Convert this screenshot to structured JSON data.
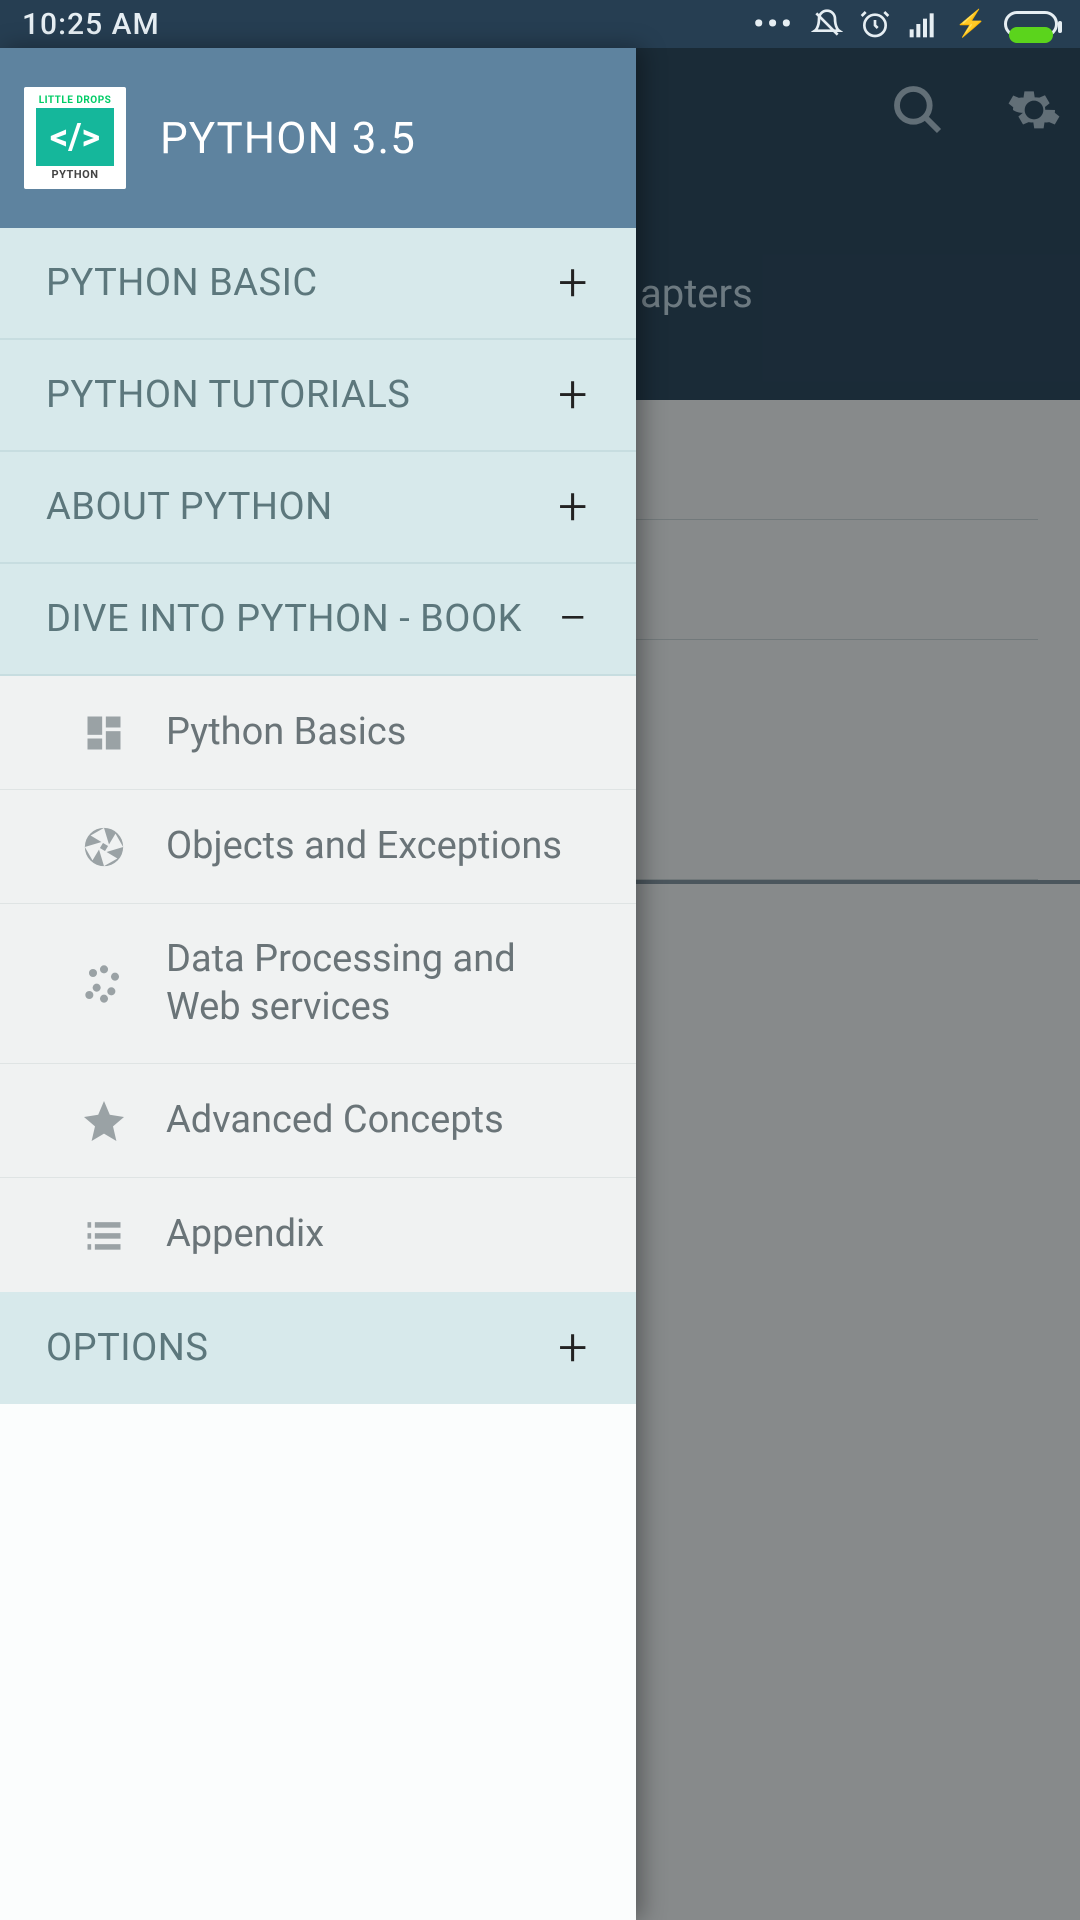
{
  "status": {
    "time": "10:25 AM"
  },
  "main": {
    "tab_label": "apters"
  },
  "drawer": {
    "logo": {
      "top": "LITTLE DROPS",
      "bottom": "PYTHON"
    },
    "title": "PYTHON 3.5",
    "sections": [
      {
        "label": "PYTHON BASIC",
        "toggle": "+"
      },
      {
        "label": "PYTHON TUTORIALS",
        "toggle": "+"
      },
      {
        "label": "ABOUT PYTHON",
        "toggle": "+"
      },
      {
        "label": "DIVE INTO PYTHON - BOOK",
        "toggle": "−"
      },
      {
        "label": "OPTIONS",
        "toggle": "+"
      }
    ],
    "dive_items": [
      {
        "label": "Python Basics"
      },
      {
        "label": "Objects and Exceptions"
      },
      {
        "label": "Data Processing and Web services"
      },
      {
        "label": "Advanced Concepts"
      },
      {
        "label": "Appendix"
      }
    ]
  }
}
